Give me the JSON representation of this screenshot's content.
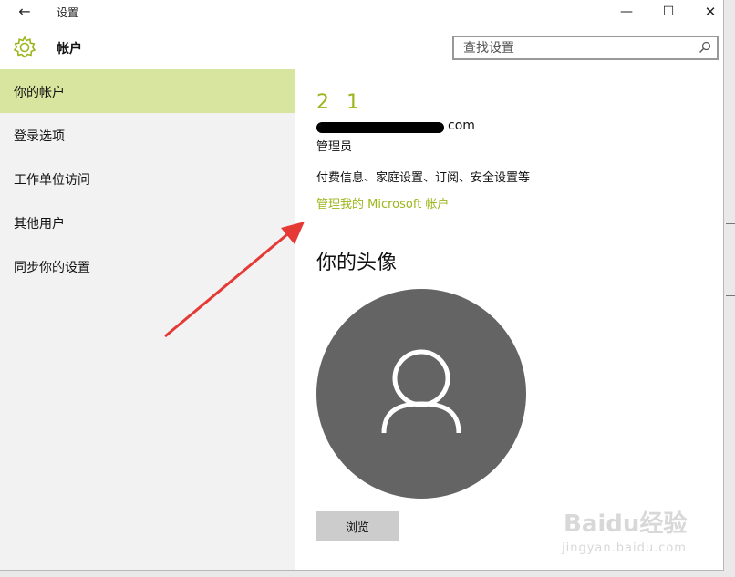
{
  "window": {
    "title": "设置",
    "back_glyph": "←",
    "minimize_glyph": "—",
    "maximize_glyph": "☐",
    "close_glyph": "✕"
  },
  "header": {
    "icon": "gear-icon",
    "title": "帐户",
    "search_placeholder": "查找设置",
    "search_icon": "search-icon"
  },
  "sidebar": {
    "items": [
      {
        "label": "你的帐户",
        "active": true
      },
      {
        "label": "登录选项",
        "active": false
      },
      {
        "label": "工作单位访问",
        "active": false
      },
      {
        "label": "其他用户",
        "active": false
      },
      {
        "label": "同步你的设置",
        "active": false
      }
    ]
  },
  "account": {
    "name": "2 1",
    "email_suffix": "com",
    "role": "管理员",
    "info": "付费信息、家庭设置、订阅、安全设置等",
    "manage_link": "管理我的 Microsoft 帐户"
  },
  "avatar_section": {
    "title": "你的头像",
    "browse_label": "浏览",
    "avatar_icon": "user-icon"
  },
  "watermark": {
    "logo": "Baidu经验",
    "url": "jingyan.baidu.com"
  },
  "colors": {
    "accent": "#9cb51b",
    "active_nav": "#d8e59e",
    "sidebar_bg": "#f2f2f2",
    "avatar_bg": "#646464",
    "arrow": "#e53935"
  }
}
